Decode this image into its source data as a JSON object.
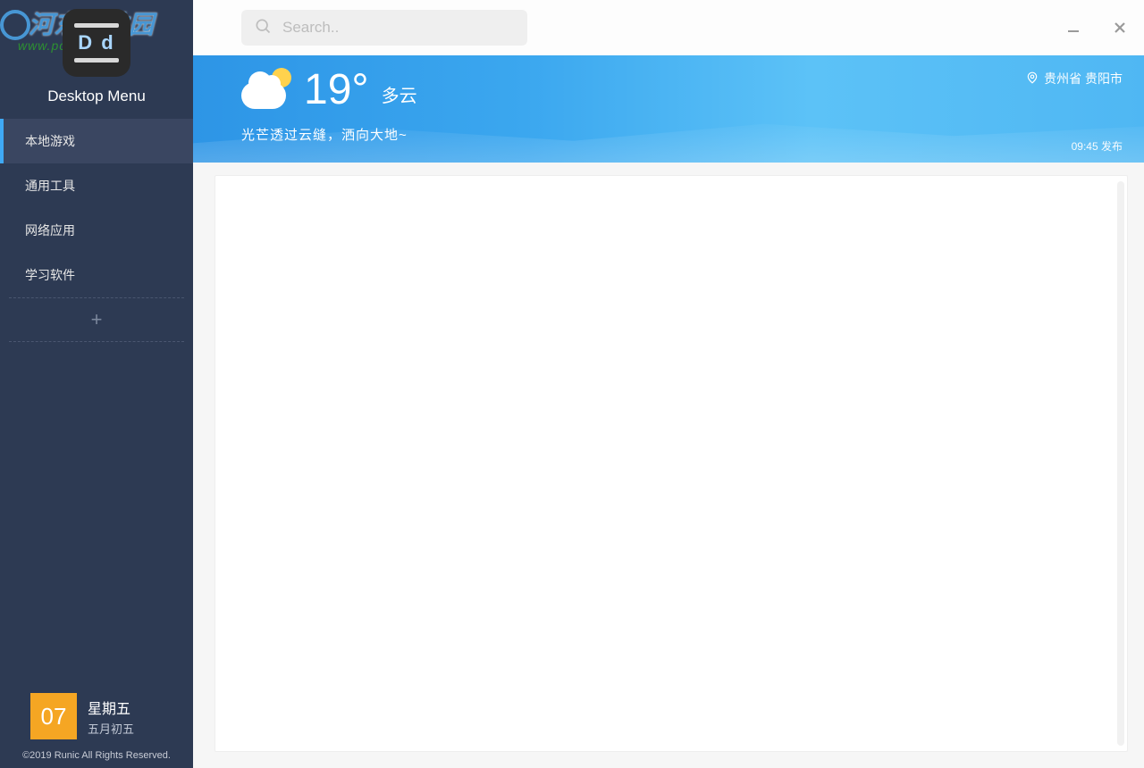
{
  "sidebar": {
    "app_title": "Desktop Menu",
    "watermark_text": "河东软件园",
    "watermark_url": "www.pc0359.cn",
    "nav": [
      {
        "label": "本地游戏",
        "active": true
      },
      {
        "label": "通用工具",
        "active": false
      },
      {
        "label": "网络应用",
        "active": false
      },
      {
        "label": "学习软件",
        "active": false
      }
    ],
    "add_label": "+",
    "date": {
      "day": "07",
      "weekday": "星期五",
      "lunar": "五月初五"
    },
    "copyright": "©2019 Runic All Rights Reserved."
  },
  "topbar": {
    "search_placeholder": "Search.."
  },
  "weather": {
    "temperature": "19°",
    "condition": "多云",
    "description": "光芒透过云缝，洒向大地~",
    "location": "贵州省 贵阳市",
    "publish": "09:45 发布"
  }
}
